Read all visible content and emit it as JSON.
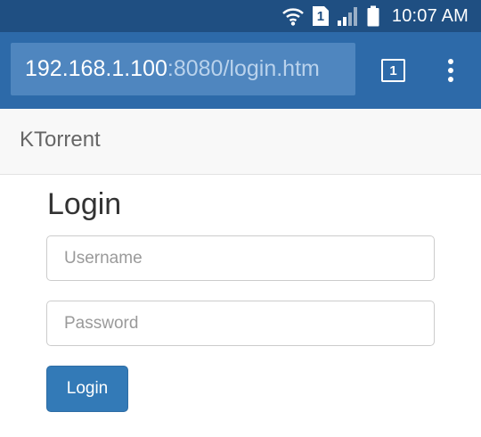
{
  "status_bar": {
    "sim_slot": "1",
    "time": "10:07 AM"
  },
  "browser": {
    "url_host": "192.168.1.100",
    "url_path": ":8080/login.htm",
    "tab_count": "1"
  },
  "navbar": {
    "brand": "KTorrent"
  },
  "login_form": {
    "heading": "Login",
    "username_placeholder": "Username",
    "password_placeholder": "Password",
    "submit_label": "Login"
  },
  "colors": {
    "status_bar": "#1f4f82",
    "browser_toolbar": "#2d6aa9",
    "url_box": "#4f86bf",
    "primary_button": "#337ab7"
  },
  "icons": [
    "wifi-icon",
    "sim-icon",
    "signal-icon",
    "battery-icon",
    "tabs-icon",
    "overflow-menu-icon"
  ]
}
